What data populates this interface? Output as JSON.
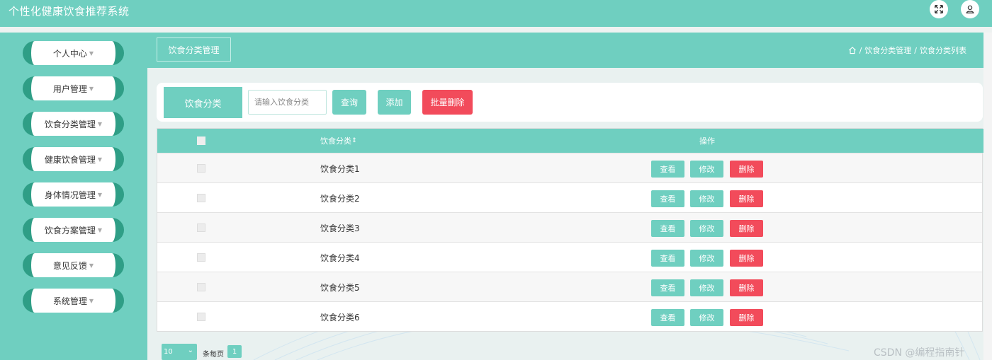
{
  "app": {
    "title": "个性化健康饮食推荐系统"
  },
  "header_icons": [
    "fullscreen-icon",
    "user-icon"
  ],
  "sidebar": {
    "items": [
      {
        "label": "个人中心"
      },
      {
        "label": "用户管理"
      },
      {
        "label": "饮食分类管理"
      },
      {
        "label": "健康饮食管理"
      },
      {
        "label": "身体情况管理"
      },
      {
        "label": "饮食方案管理"
      },
      {
        "label": "意见反馈"
      },
      {
        "label": "系统管理"
      }
    ],
    "caret": "▼"
  },
  "page": {
    "title": "饮食分类管理",
    "breadcrumb": [
      "饮食分类管理",
      "饮食分类列表"
    ],
    "breadcrumb_sep": "/"
  },
  "search": {
    "label": "饮食分类",
    "placeholder": "请输入饮食分类",
    "value": "",
    "query_btn": "查询",
    "add_btn": "添加",
    "batch_delete_btn": "批量删除"
  },
  "table": {
    "headers": {
      "category": "饮食分类",
      "sort_icon": "⇕",
      "actions": "操作"
    },
    "rows": [
      {
        "category": "饮食分类1"
      },
      {
        "category": "饮食分类2"
      },
      {
        "category": "饮食分类3"
      },
      {
        "category": "饮食分类4"
      },
      {
        "category": "饮食分类5"
      },
      {
        "category": "饮食分类6"
      }
    ],
    "actions": {
      "view": "查看",
      "edit": "修改",
      "delete": "删除"
    }
  },
  "pagination": {
    "page_size": "10",
    "per_page_label": "条每页",
    "current_page": "1"
  },
  "watermark": "CSDN @编程指南针",
  "colors": {
    "primary": "#6fcfc0",
    "sidebar_accent": "#2f9e86",
    "danger": "#f24b5b"
  }
}
